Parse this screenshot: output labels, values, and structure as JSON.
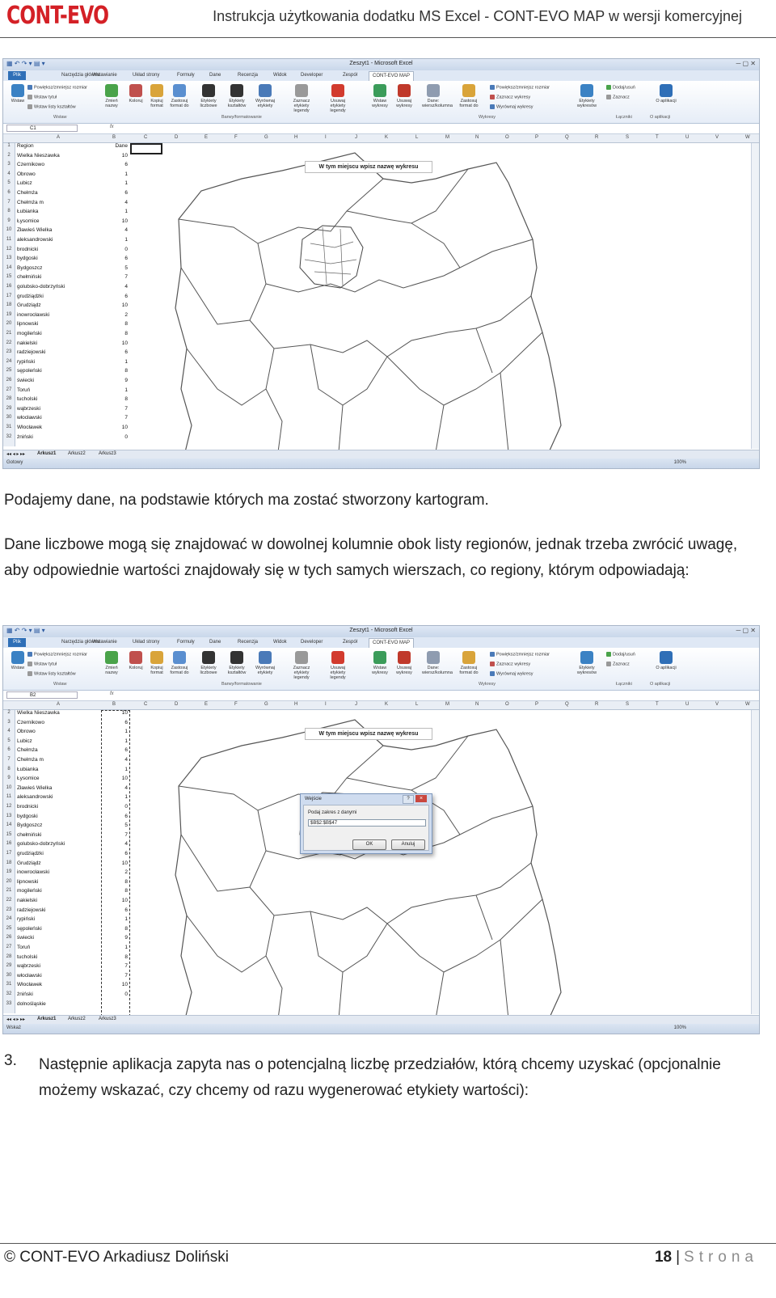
{
  "header": {
    "logo": "CONT-EVO",
    "title": "Instrukcja użytkowania dodatku MS Excel - CONT-EVO MAP w wersji komercyjnej"
  },
  "excel": {
    "window_title": "Zeszyt1 - Microsoft Excel",
    "tabs": [
      "Plik",
      "Narzędzia główne",
      "Wstawianie",
      "Układ strony",
      "Formuły",
      "Dane",
      "Recenzja",
      "Widok",
      "Developer",
      "Zespół",
      "CONT-EVO MAP"
    ],
    "ribbon": {
      "wstaw": "Wstaw",
      "resize": "Powiększ/zmniejsz rozmiar",
      "insert_title": "Wstaw tytuł",
      "insert_shape_list": "Wstaw listy kształtów",
      "rename": "Zmień nazwy",
      "colors": "Koloruj",
      "copy_format": "Kopiuj format",
      "apply_format": "Zastosuj format do",
      "num_labels": "Etykiety liczbowe",
      "shape_labels": "Etykiety kształtów",
      "align_labels": "Wyrównaj etykiety",
      "select_legend_labels": "Zaznacz etykiety legendy",
      "remove_legend_labels": "Usuwaj etykiety legendy",
      "insert_charts": "Wstaw wykresy",
      "remove_charts": "Usuwaj wykresy",
      "data_row_col": "Dane: wiersz/kolumna",
      "apply_format2": "Zastosuj format do",
      "resize2": "Powiększ/zmniejsz rozmiar",
      "select_charts": "Zaznacz wykresy",
      "align_charts": "Wyrównaj wykresy",
      "chart_labels": "Etykiety wykresów",
      "add_remove": "Dodaj/usuń",
      "select": "Zaznacz",
      "about": "O aplikacji",
      "groups": [
        "Wstaw",
        "Barwy/formatowanie",
        "Wykresy",
        "Łączniki",
        "O aplikacji"
      ]
    },
    "columns": [
      "A",
      "B",
      "C",
      "D",
      "E",
      "F",
      "G",
      "H",
      "I",
      "J",
      "K",
      "L",
      "M",
      "N",
      "O",
      "P",
      "Q",
      "R",
      "S",
      "T",
      "U",
      "V",
      "W"
    ],
    "sheet_tabs": [
      "Arkusz1",
      "Arkusz2",
      "Arkusz3"
    ],
    "chart_title": "W tym miejscu wpisz nazwę wykresu",
    "screenshot1": {
      "name_box": "C1",
      "status": "Gotowy",
      "zoom": "100%",
      "rows": [
        {
          "n": "1",
          "a": "Region",
          "b": "Dane"
        },
        {
          "n": "2",
          "a": "Wielka Nieszawka",
          "b": "10"
        },
        {
          "n": "3",
          "a": "Czernikowo",
          "b": "6"
        },
        {
          "n": "4",
          "a": "Obrowo",
          "b": "1"
        },
        {
          "n": "5",
          "a": "Lubicz",
          "b": "1"
        },
        {
          "n": "6",
          "a": "Chełmża",
          "b": "6"
        },
        {
          "n": "7",
          "a": "Chełmża m",
          "b": "4"
        },
        {
          "n": "8",
          "a": "Łubianka",
          "b": "1"
        },
        {
          "n": "9",
          "a": "Łysomice",
          "b": "10"
        },
        {
          "n": "10",
          "a": "Zławieś Wielka",
          "b": "4"
        },
        {
          "n": "11",
          "a": "aleksandrowski",
          "b": "1"
        },
        {
          "n": "12",
          "a": "brodnicki",
          "b": "0"
        },
        {
          "n": "13",
          "a": "bydgoski",
          "b": "6"
        },
        {
          "n": "14",
          "a": "Bydgoszcz",
          "b": "5"
        },
        {
          "n": "15",
          "a": "chełmiński",
          "b": "7"
        },
        {
          "n": "16",
          "a": "golubsko-dobrzyński",
          "b": "4"
        },
        {
          "n": "17",
          "a": "grudziądzki",
          "b": "6"
        },
        {
          "n": "18",
          "a": "Grudziądz",
          "b": "10"
        },
        {
          "n": "19",
          "a": "inowrocławski",
          "b": "2"
        },
        {
          "n": "20",
          "a": "lipnowski",
          "b": "8"
        },
        {
          "n": "21",
          "a": "mogileński",
          "b": "8"
        },
        {
          "n": "22",
          "a": "nakielski",
          "b": "10"
        },
        {
          "n": "23",
          "a": "radziejowski",
          "b": "6"
        },
        {
          "n": "24",
          "a": "rypiński",
          "b": "1"
        },
        {
          "n": "25",
          "a": "sępoleński",
          "b": "8"
        },
        {
          "n": "26",
          "a": "świecki",
          "b": "9"
        },
        {
          "n": "27",
          "a": "Toruń",
          "b": "1"
        },
        {
          "n": "28",
          "a": "tucholski",
          "b": "8"
        },
        {
          "n": "29",
          "a": "wąbrzeski",
          "b": "7"
        },
        {
          "n": "30",
          "a": "włocławski",
          "b": "7"
        },
        {
          "n": "31",
          "a": "Włocławek",
          "b": "10"
        },
        {
          "n": "32",
          "a": "żniński",
          "b": "0"
        }
      ]
    },
    "screenshot2": {
      "name_box": "B2",
      "status": "Wskaż",
      "zoom": "100%",
      "rows": [
        {
          "n": "2",
          "a": "Wielka Nieszawka",
          "b": "10"
        },
        {
          "n": "3",
          "a": "Czernikowo",
          "b": "6"
        },
        {
          "n": "4",
          "a": "Obrowo",
          "b": "1"
        },
        {
          "n": "5",
          "a": "Lubicz",
          "b": "1"
        },
        {
          "n": "6",
          "a": "Chełmża",
          "b": "6"
        },
        {
          "n": "7",
          "a": "Chełmża m",
          "b": "4"
        },
        {
          "n": "8",
          "a": "Łubianka",
          "b": "1"
        },
        {
          "n": "9",
          "a": "Łysomice",
          "b": "10"
        },
        {
          "n": "10",
          "a": "Zławieś Wielka",
          "b": "4"
        },
        {
          "n": "11",
          "a": "aleksandrowski",
          "b": "1"
        },
        {
          "n": "12",
          "a": "brodnicki",
          "b": "0"
        },
        {
          "n": "13",
          "a": "bydgoski",
          "b": "6"
        },
        {
          "n": "14",
          "a": "Bydgoszcz",
          "b": "5"
        },
        {
          "n": "15",
          "a": "chełmiński",
          "b": "7"
        },
        {
          "n": "16",
          "a": "golubsko-dobrzyński",
          "b": "4"
        },
        {
          "n": "17",
          "a": "grudziądzki",
          "b": "6"
        },
        {
          "n": "18",
          "a": "Grudziądz",
          "b": "10"
        },
        {
          "n": "19",
          "a": "inowrocławski",
          "b": "2"
        },
        {
          "n": "20",
          "a": "lipnowski",
          "b": "8"
        },
        {
          "n": "21",
          "a": "mogileński",
          "b": "8"
        },
        {
          "n": "22",
          "a": "nakielski",
          "b": "10"
        },
        {
          "n": "23",
          "a": "radziejowski",
          "b": "6"
        },
        {
          "n": "24",
          "a": "rypiński",
          "b": "1"
        },
        {
          "n": "25",
          "a": "sępoleński",
          "b": "8"
        },
        {
          "n": "26",
          "a": "świecki",
          "b": "9"
        },
        {
          "n": "27",
          "a": "Toruń",
          "b": "1"
        },
        {
          "n": "28",
          "a": "tucholski",
          "b": "8"
        },
        {
          "n": "29",
          "a": "wąbrzeski",
          "b": "7"
        },
        {
          "n": "30",
          "a": "włocławski",
          "b": "7"
        },
        {
          "n": "31",
          "a": "Włocławek",
          "b": "10"
        },
        {
          "n": "32",
          "a": "żniński",
          "b": "0"
        },
        {
          "n": "33",
          "a": "dolnośląskie",
          "b": ""
        }
      ],
      "dialog": {
        "title": "Wejście",
        "help": "?",
        "close": "×",
        "prompt": "Podaj zakres z danymi",
        "value": "$B$2:$B$47",
        "ok": "OK",
        "cancel": "Anuluj"
      }
    }
  },
  "text": {
    "p1": "Podajemy dane, na podstawie których ma zostać stworzony kartogram.",
    "p2": "Dane liczbowe mogą się znajdować w dowolnej kolumnie obok listy regionów, jednak trzeba zwrócić uwagę, aby odpowiednie wartości znajdowały się w tych samych wierszach, co regiony, którym odpowiadają:",
    "num3": "3.",
    "p3": "Następnie aplikacja zapyta nas o potencjalną liczbę przedziałów, którą chcemy uzyskać (opcjonalnie możemy wskazać, czy chcemy od razu wygenerować etykiety wartości):"
  },
  "footer": {
    "left": "© CONT-EVO Arkadiusz Doliński",
    "page": "18",
    "sep": "|",
    "strona": "Strona"
  }
}
